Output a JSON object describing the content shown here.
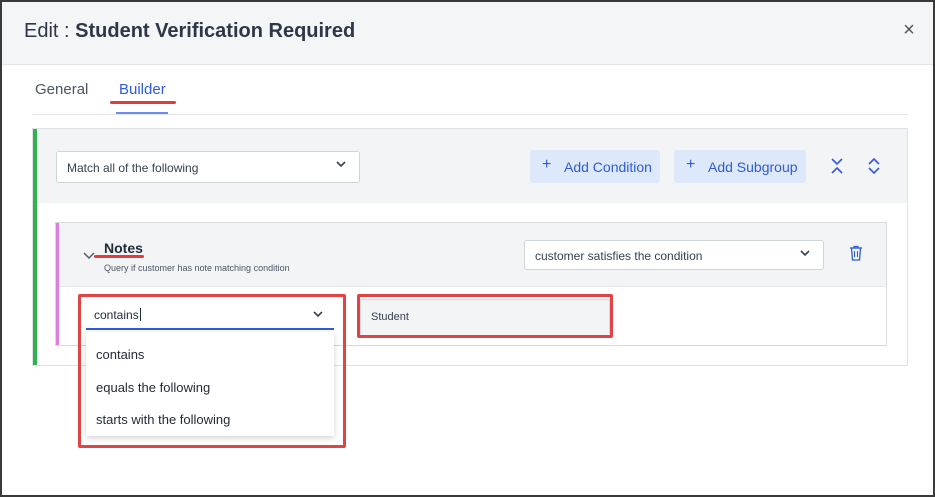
{
  "modal": {
    "title_prefix": "Edit :",
    "title_strong": "Student Verification Required",
    "close_glyph": "×"
  },
  "tabs": [
    {
      "label": "General",
      "active": false
    },
    {
      "label": "Builder",
      "active": true
    }
  ],
  "builder": {
    "match_select": {
      "value": "Match all of the following"
    },
    "add_condition": {
      "icon": "plus-icon",
      "label": "Add Condition"
    },
    "add_subgroup": {
      "icon": "plus-icon",
      "label": "Add Subgroup"
    },
    "collapse_icon": "collapse-all-icon",
    "expand_icon": "expand-all-icon"
  },
  "rule": {
    "title": "Notes",
    "subtitle": "Query if customer has note matching condition",
    "condition_select": {
      "value": "customer satisfies the condition"
    },
    "operator_input": {
      "value": "contains"
    },
    "value_input": {
      "value": "Student"
    },
    "delete_icon": "trash-icon"
  },
  "operator_dropdown": {
    "options": [
      "contains",
      "equals the following",
      "starts with the following"
    ]
  },
  "colors": {
    "accent_blue": "#2f5bd6",
    "button_bg": "#dde8fb",
    "group_accent": "#2fb34a",
    "rule_accent": "#e07be0",
    "annotation_red": "#e04545"
  }
}
